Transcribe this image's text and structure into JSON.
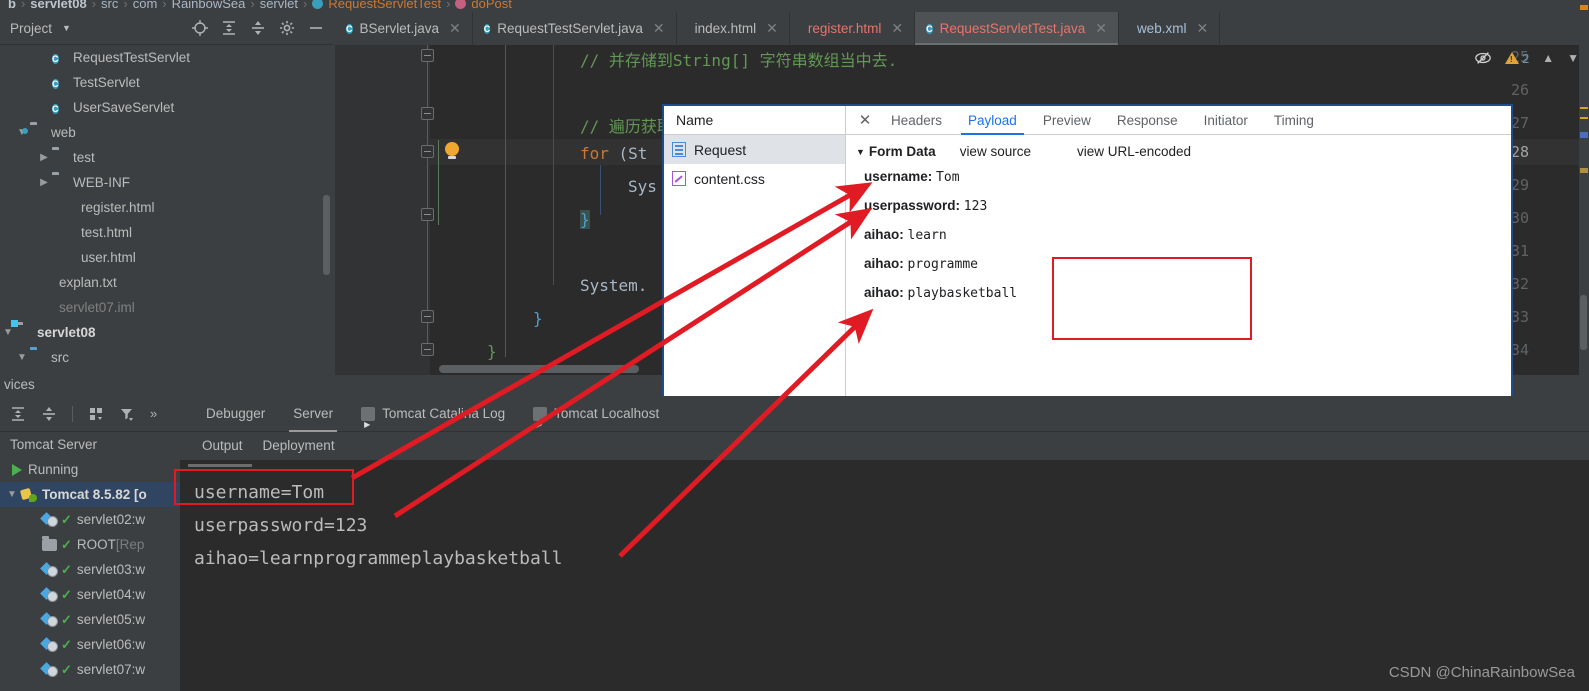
{
  "breadcrumb": {
    "items": [
      "b",
      "servlet08",
      "src",
      "com",
      "RainbowSea",
      "servlet",
      "RequestServletTest",
      "doPost"
    ]
  },
  "project_panel": {
    "title": "Project",
    "tools": [
      "locate-icon",
      "expand-all-icon",
      "collapse-all-icon",
      "settings-icon",
      "hide-icon"
    ],
    "tree": [
      {
        "label": "RequestTestServlet",
        "icon": "java-class-icon",
        "indent": 3,
        "arrow": ""
      },
      {
        "label": "TestServlet",
        "icon": "java-class-icon",
        "indent": 3,
        "arrow": ""
      },
      {
        "label": "UserSaveServlet",
        "icon": "java-class-icon",
        "indent": 3,
        "arrow": ""
      },
      {
        "label": "web",
        "icon": "web-folder-icon",
        "indent": 1,
        "arrow": "v"
      },
      {
        "label": "test",
        "icon": "folder-icon",
        "indent": 2,
        "arrow": ">"
      },
      {
        "label": "WEB-INF",
        "icon": "folder-icon",
        "indent": 2,
        "arrow": ">"
      },
      {
        "label": "register.html",
        "icon": "html-file-icon",
        "indent": 2.6,
        "arrow": ""
      },
      {
        "label": "test.html",
        "icon": "html-file-icon",
        "indent": 2.6,
        "arrow": ""
      },
      {
        "label": "user.html",
        "icon": "html-file-icon",
        "indent": 2.6,
        "arrow": ""
      },
      {
        "label": "explan.txt",
        "icon": "text-file-icon",
        "indent": 1.6,
        "arrow": ""
      },
      {
        "label": "servlet07.iml",
        "icon": "iml-file-icon",
        "indent": 1.6,
        "arrow": "",
        "dim": true
      },
      {
        "label": "servlet08",
        "icon": "module-folder-icon",
        "indent": 0,
        "arrow": "v",
        "bold": true
      },
      {
        "label": "src",
        "icon": "source-folder-icon",
        "indent": 1,
        "arrow": "v"
      }
    ]
  },
  "editor": {
    "tabs": [
      {
        "label": "BServlet.java",
        "icon": "java-class-icon",
        "active": false,
        "color": "normal"
      },
      {
        "label": "RequestTestServlet.java",
        "icon": "java-class-icon",
        "active": false,
        "color": "normal"
      },
      {
        "label": "index.html",
        "icon": "html-file-icon",
        "active": false,
        "color": "normal"
      },
      {
        "label": "register.html",
        "icon": "html-file-icon",
        "active": false,
        "color": "red"
      },
      {
        "label": "RequestServletTest.java",
        "icon": "java-class-icon",
        "active": true,
        "color": "red"
      },
      {
        "label": "web.xml",
        "icon": "xml-file-icon",
        "active": false,
        "color": "blue"
      }
    ],
    "status": {
      "inspection_icon": "eye-off-icon",
      "warning_count": "2",
      "up_icon": "chevron-up-icon",
      "down_icon": "chevron-down-icon"
    },
    "lines": [
      {
        "num": "25",
        "text": "// 并存储到String[] 字符串数组当中去.",
        "kind": "comment",
        "indent": 8
      },
      {
        "num": "26",
        "text": "",
        "kind": "plain",
        "indent": 0
      },
      {
        "num": "27",
        "text": "// 遍历获取到的",
        "kind": "comment",
        "indent": 8
      },
      {
        "num": "28",
        "text": "for (St",
        "kind": "for",
        "indent": 8,
        "current": true
      },
      {
        "num": "29",
        "text": "Sys",
        "kind": "plain",
        "indent": 12
      },
      {
        "num": "30",
        "text": "}",
        "kind": "brace-hl",
        "indent": 8
      },
      {
        "num": "31",
        "text": "",
        "kind": "plain",
        "indent": 0
      },
      {
        "num": "32",
        "text": "System.",
        "kind": "plain",
        "indent": 8
      },
      {
        "num": "33",
        "text": "}",
        "kind": "brace",
        "indent": 5
      },
      {
        "num": "34",
        "text": "}",
        "kind": "brace-green",
        "indent": 2
      }
    ]
  },
  "devtools": {
    "left_header": "Name",
    "requests": [
      {
        "name": "Request",
        "icon": "document-icon",
        "selected": true
      },
      {
        "name": "content.css",
        "icon": "css-file-icon",
        "selected": false
      }
    ],
    "close_icon": "close-icon",
    "tabs": [
      "Headers",
      "Payload",
      "Preview",
      "Response",
      "Initiator",
      "Timing"
    ],
    "active_tab": "Payload",
    "form_data": {
      "section_title": "Form Data",
      "view_source_label": "view source",
      "view_url_encoded_label": "view URL-encoded",
      "entries": [
        {
          "key": "username:",
          "value": "Tom",
          "boxed": false
        },
        {
          "key": "userpassword:",
          "value": "123",
          "boxed": false
        },
        {
          "key": "aihao:",
          "value": "learn",
          "boxed": true
        },
        {
          "key": "aihao:",
          "value": "programme",
          "boxed": true
        },
        {
          "key": "aihao:",
          "value": "playbasketball",
          "boxed": true
        }
      ]
    }
  },
  "services": {
    "panel_label": "vices",
    "toolbar": [
      "expand-all-icon",
      "collapse-all-icon",
      "group-icon",
      "filter-icon",
      "more-icon"
    ],
    "tree": [
      {
        "label": "Tomcat Server",
        "kind": "header"
      },
      {
        "label": "Running",
        "kind": "running"
      },
      {
        "label": "Tomcat 8.5.82 [",
        "suffix": "o",
        "kind": "server",
        "selected": true,
        "bold": true
      },
      {
        "label": "servlet02:w",
        "kind": "war"
      },
      {
        "label": "ROOT ",
        "suffix": "[Rep",
        "kind": "root"
      },
      {
        "label": "servlet03:w",
        "kind": "war"
      },
      {
        "label": "servlet04:w",
        "kind": "war"
      },
      {
        "label": "servlet05:w",
        "kind": "war"
      },
      {
        "label": "servlet06:w",
        "kind": "war"
      },
      {
        "label": "servlet07:w",
        "kind": "war"
      }
    ]
  },
  "run_panel": {
    "tabs": [
      {
        "label": "Debugger",
        "active": false,
        "icon": ""
      },
      {
        "label": "Server",
        "active": true,
        "icon": ""
      },
      {
        "label": "Tomcat Catalina Log",
        "active": false,
        "icon": "log-icon"
      },
      {
        "label": "Tomcat Localhost",
        "active": false,
        "icon": "log-icon"
      }
    ],
    "subtabs": [
      {
        "label": "Output",
        "active": false
      },
      {
        "label": "Deployment",
        "active": false
      }
    ],
    "console_lines": [
      "username=Tom",
      "userpassword=123",
      "aihao=learnprogrammeplaybasketball"
    ]
  },
  "watermark": "CSDN @ChinaRainbowSea",
  "colors": {
    "ide_bg": "#3c3f41",
    "editor_bg": "#2b2b2b",
    "accent_blue": "#1a73e8",
    "annotation_red": "#e01b24",
    "warning_yellow": "#e0a33a",
    "success_green": "#4caf50"
  }
}
